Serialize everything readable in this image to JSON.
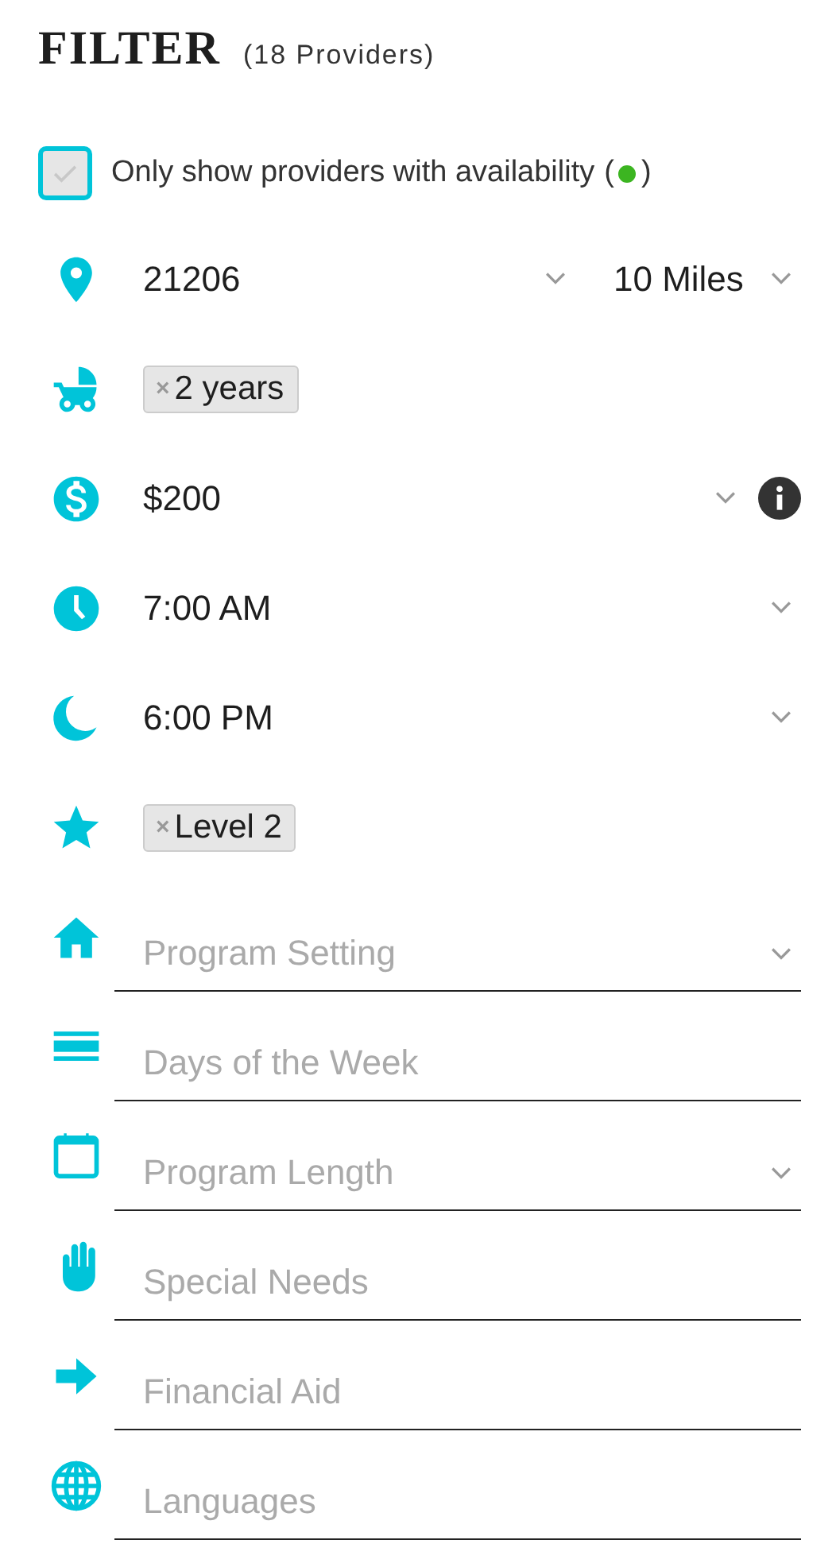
{
  "header": {
    "title": "FILTER",
    "count": "(18 Providers)"
  },
  "availability": {
    "label": "Only show providers with availability",
    "checked": true,
    "disabled": true,
    "legend_open": "(",
    "legend_close": ")"
  },
  "filters": [
    {
      "kind": "location",
      "value": "21206",
      "dropdown": true,
      "radius": "10 Miles",
      "radius_dropdown": true
    },
    {
      "kind": "tag",
      "tag": "2 years",
      "remove": "×"
    },
    {
      "kind": "select",
      "value": "$200",
      "dropdown": true,
      "info": true
    },
    {
      "kind": "select",
      "value": "7:00 AM",
      "dropdown": true
    },
    {
      "kind": "select",
      "value": "6:00 PM",
      "dropdown": true
    },
    {
      "kind": "tag",
      "tag": "Level 2",
      "remove": "×"
    },
    {
      "kind": "input",
      "placeholder": "Program Setting",
      "dropdown": true
    },
    {
      "kind": "input",
      "placeholder": "Days of the Week",
      "dropdown": false
    },
    {
      "kind": "input",
      "placeholder": "Program Length",
      "dropdown": true
    },
    {
      "kind": "input",
      "placeholder": "Special Needs",
      "dropdown": false
    },
    {
      "kind": "input",
      "placeholder": "Financial Aid",
      "dropdown": false
    },
    {
      "kind": "input",
      "placeholder": "Languages",
      "dropdown": false
    }
  ]
}
